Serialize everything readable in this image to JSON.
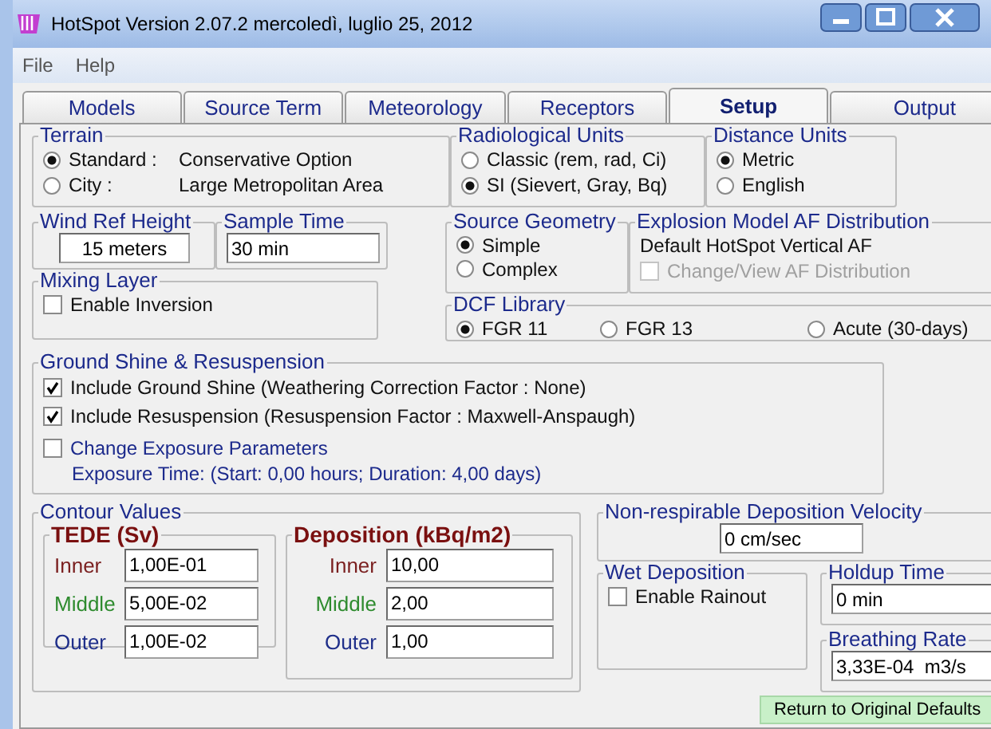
{
  "window": {
    "title": "HotSpot Version 2.07.2  mercoledì, luglio 25, 2012"
  },
  "menu": [
    "File",
    "Help"
  ],
  "tabs": [
    {
      "label": "Models",
      "selected": false
    },
    {
      "label": "Source Term",
      "selected": false
    },
    {
      "label": "Meteorology",
      "selected": false
    },
    {
      "label": "Receptors",
      "selected": false
    },
    {
      "label": "Setup",
      "selected": true
    },
    {
      "label": "Output",
      "selected": false
    }
  ],
  "terrain": {
    "title": "Terrain",
    "options": [
      {
        "label": "Standard :",
        "description": "Conservative Option",
        "selected": true
      },
      {
        "label": "City :",
        "description": "Large Metropolitan Area",
        "selected": false
      }
    ]
  },
  "radiological_units": {
    "title": "Radiological Units",
    "options": [
      {
        "label": "Classic (rem, rad, Ci)",
        "selected": false
      },
      {
        "label": "SI (Sievert,  Gray, Bq)",
        "selected": true
      }
    ]
  },
  "distance_units": {
    "title": "Distance Units",
    "options": [
      {
        "label": "Metric",
        "selected": true
      },
      {
        "label": "English",
        "selected": false
      }
    ]
  },
  "wind_ref_height": {
    "title": "Wind Ref Height",
    "value": "15 meters"
  },
  "sample_time": {
    "title": "Sample Time",
    "value": "30 min"
  },
  "mixing_layer": {
    "title": "Mixing Layer",
    "checkbox": {
      "label": "Enable Inversion",
      "checked": false
    }
  },
  "source_geometry": {
    "title": "Source Geometry",
    "options": [
      {
        "label": "Simple",
        "selected": true
      },
      {
        "label": "Complex",
        "selected": false
      }
    ]
  },
  "explosion_model": {
    "title": "Explosion Model AF Distribution",
    "text": "Default HotSpot Vertical AF",
    "checkbox": {
      "label": "Change/View AF Distribution",
      "checked": false,
      "disabled": true
    }
  },
  "dcf_library": {
    "title": "DCF Library",
    "options": [
      {
        "label": "FGR 11",
        "selected": true
      },
      {
        "label": "FGR 13",
        "selected": false
      },
      {
        "label": "Acute (30-days)",
        "selected": false
      }
    ]
  },
  "ground_shine": {
    "title": "Ground Shine & Resuspension",
    "checkboxes": [
      {
        "label": "Include Ground Shine (Weathering Correction Factor : None)",
        "checked": true,
        "kind": "plain"
      },
      {
        "label": "Include Resuspension (Resuspension Factor : Maxwell-Anspaugh)",
        "checked": true,
        "kind": "plain"
      },
      {
        "label": "Change Exposure Parameters",
        "checked": false,
        "kind": "accent"
      }
    ],
    "exposure_time": "Exposure Time: (Start: 0,00 hours; Duration: 4,00 days)"
  },
  "contour_values": {
    "title": "Contour Values",
    "groups": [
      {
        "title": "TEDE (Sv)",
        "rows": [
          {
            "label": "Inner",
            "value": "1,00E-01",
            "color": "#7a1f1f"
          },
          {
            "label": "Middle",
            "value": "5,00E-02",
            "color": "#2e8b2e"
          },
          {
            "label": "Outer",
            "value": "1,00E-02",
            "color": "#1f2f8a"
          }
        ]
      },
      {
        "title": "Deposition (kBq/m2)",
        "rows": [
          {
            "label": "Inner",
            "value": "10,00",
            "color": "#7a1f1f"
          },
          {
            "label": "Middle",
            "value": "2,00",
            "color": "#2e8b2e"
          },
          {
            "label": "Outer",
            "value": "1,00",
            "color": "#1f2f8a"
          }
        ]
      }
    ]
  },
  "deposition_velocity": {
    "title": "Non-respirable Deposition Velocity",
    "value": "0 cm/sec"
  },
  "wet_deposition": {
    "title": "Wet Deposition",
    "checkbox": {
      "label": "Enable Rainout",
      "checked": false
    }
  },
  "holdup_time": {
    "title": "Holdup Time",
    "value": "0 min"
  },
  "breathing_rate": {
    "title": "Breathing Rate",
    "value": "3,33E-04  m3/s"
  },
  "return_button": {
    "label": "Return to Original Defaults"
  }
}
